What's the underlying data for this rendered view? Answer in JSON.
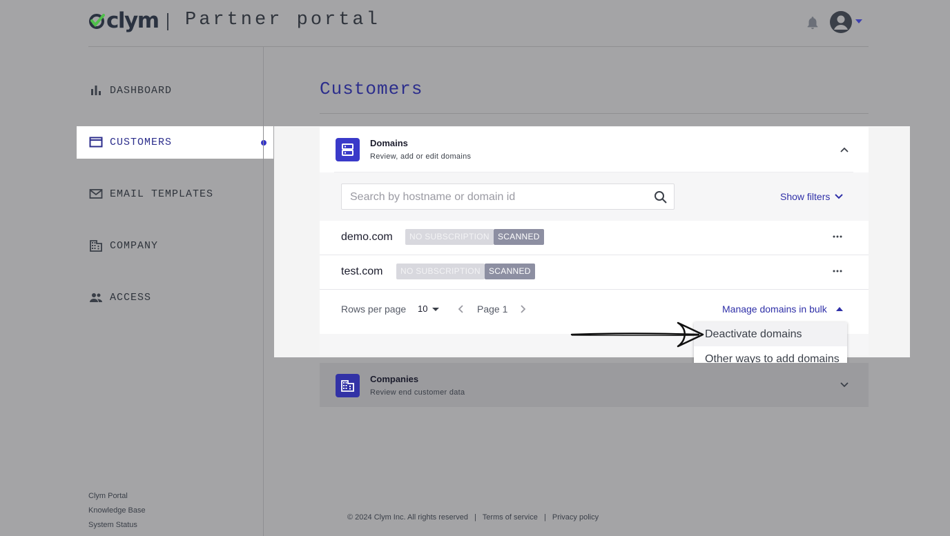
{
  "header": {
    "logo_text": "clym",
    "portal_title": "Partner portal"
  },
  "sidebar": {
    "items": [
      {
        "label": "DASHBOARD",
        "icon": "bar-chart-icon"
      },
      {
        "label": "CUSTOMERS",
        "icon": "folder-icon",
        "active": true
      },
      {
        "label": "EMAIL TEMPLATES",
        "icon": "mail-icon"
      },
      {
        "label": "COMPANY",
        "icon": "building-icon"
      },
      {
        "label": "ACCESS",
        "icon": "people-icon"
      }
    ],
    "footer_links": [
      "Clym Portal",
      "Knowledge Base",
      "System Status"
    ]
  },
  "main": {
    "title": "Customers",
    "domains_card": {
      "title": "Domains",
      "subtitle": "Review, add or edit domains",
      "search_placeholder": "Search by hostname or domain id",
      "show_filters": "Show filters",
      "rows": [
        {
          "domain": "demo.com",
          "tags": [
            "NO SUBSCRIPTION",
            "SCANNED"
          ]
        },
        {
          "domain": "test.com",
          "tags": [
            "NO SUBSCRIPTION",
            "SCANNED"
          ]
        }
      ],
      "rows_per_page_label": "Rows per page",
      "rows_per_page_value": "10",
      "page_label": "Page 1",
      "bulk_label": "Manage domains in bulk",
      "bulk_menu": [
        "Deactivate domains",
        "Other ways to add domains"
      ]
    },
    "companies_card": {
      "title": "Companies",
      "subtitle": "Review end customer data"
    }
  },
  "footer": {
    "copyright": "© 2024 Clym Inc. All rights reserved",
    "sep": "|",
    "terms": "Terms of service",
    "privacy": "Privacy policy"
  },
  "colors": {
    "accent": "#2f30a8",
    "badge": "#3a3ac9",
    "overlay": "#a4a4a6"
  }
}
